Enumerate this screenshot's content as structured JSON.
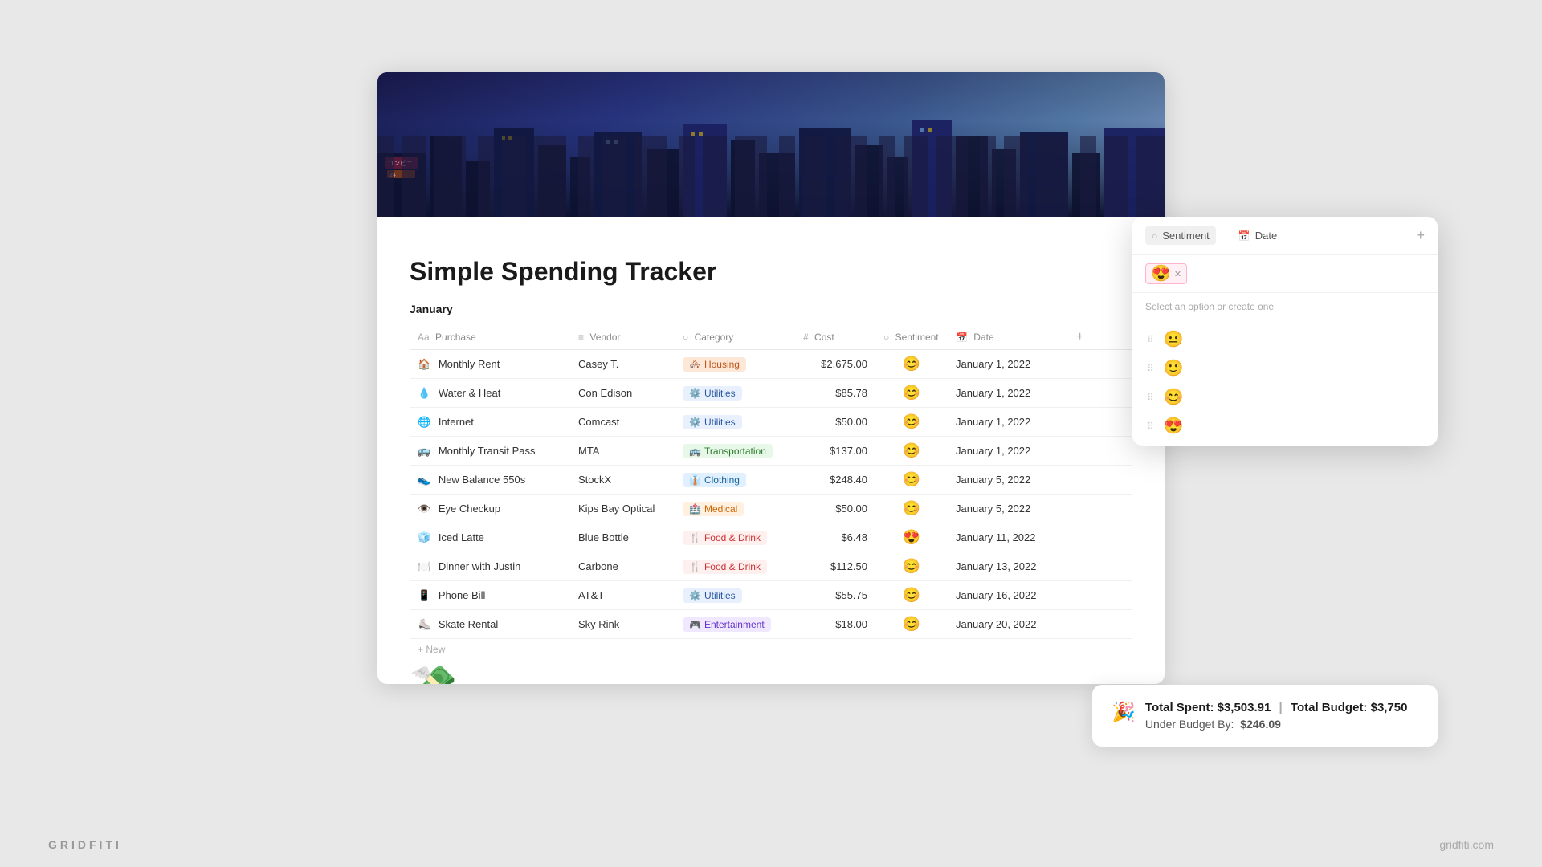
{
  "page": {
    "title": "Simple Spending Tracker",
    "icon": "💸",
    "section": "January"
  },
  "table": {
    "columns": [
      {
        "key": "purchase",
        "label": "Purchase",
        "icon": "Aa"
      },
      {
        "key": "vendor",
        "label": "Vendor",
        "icon": "≡"
      },
      {
        "key": "category",
        "label": "Category",
        "icon": "○"
      },
      {
        "key": "cost",
        "label": "Cost",
        "icon": "#"
      },
      {
        "key": "sentiment",
        "label": "Sentiment",
        "icon": "○"
      },
      {
        "key": "date",
        "label": "Date",
        "icon": "📅"
      }
    ],
    "rows": [
      {
        "icon": "🏠",
        "purchase": "Monthly Rent",
        "vendor": "Casey T.",
        "category": "Housing",
        "categoryTag": "housing",
        "categoryIcon": "🏘️",
        "cost": "$2,675.00",
        "sentiment": "😊",
        "date": "January 1, 2022",
        "rowNum": "00"
      },
      {
        "icon": "💧",
        "purchase": "Water & Heat",
        "vendor": "Con Edison",
        "category": "Utilities",
        "categoryTag": "utilities",
        "categoryIcon": "⚙️",
        "cost": "$85.78",
        "sentiment": "😊",
        "date": "January 1, 2022",
        "rowNum": "78"
      },
      {
        "icon": "🌐",
        "purchase": "Internet",
        "vendor": "Comcast",
        "category": "Utilities",
        "categoryTag": "utilities",
        "categoryIcon": "⚙️",
        "cost": "$50.00",
        "sentiment": "😊",
        "date": "January 1, 2022",
        "rowNum": "00"
      },
      {
        "icon": "🚌",
        "purchase": "Monthly Transit Pass",
        "vendor": "MTA",
        "category": "Transportation",
        "categoryTag": "transport",
        "categoryIcon": "🚌",
        "cost": "$137.00",
        "sentiment": "😊",
        "date": "January 1, 2022",
        "rowNum": "00"
      },
      {
        "icon": "👟",
        "purchase": "New Balance 550s",
        "vendor": "StockX",
        "category": "Clothing",
        "categoryTag": "clothing",
        "categoryIcon": "👔",
        "cost": "$248.40",
        "sentiment": "😊",
        "date": "January 5, 2022",
        "rowNum": "00"
      },
      {
        "icon": "👁️",
        "purchase": "Eye Checkup",
        "vendor": "Kips Bay Optical",
        "category": "Medical",
        "categoryTag": "medical",
        "categoryIcon": "🏥",
        "cost": "$50.00",
        "sentiment": "😊",
        "date": "January 5, 2022",
        "rowNum": "00"
      },
      {
        "icon": "🧊",
        "purchase": "Iced Latte",
        "vendor": "Blue Bottle",
        "category": "Food & Drink",
        "categoryTag": "food",
        "categoryIcon": "🍴",
        "cost": "$6.48",
        "sentiment": "😍",
        "date": "January 11, 2022",
        "rowNum": "48"
      },
      {
        "icon": "🍽️",
        "purchase": "Dinner with Justin",
        "vendor": "Carbone",
        "category": "Food & Drink",
        "categoryTag": "food",
        "categoryIcon": "🍴",
        "cost": "$112.50",
        "sentiment": "😊",
        "date": "January 13, 2022",
        "rowNum": "50"
      },
      {
        "icon": "📱",
        "purchase": "Phone Bill",
        "vendor": "AT&T",
        "category": "Utilities",
        "categoryTag": "utilities",
        "categoryIcon": "⚙️",
        "cost": "$55.75",
        "sentiment": "😊",
        "date": "January 16, 2022",
        "rowNum": "75"
      },
      {
        "icon": "⛸️",
        "purchase": "Skate Rental",
        "vendor": "Sky Rink",
        "category": "Entertainment",
        "categoryTag": "entertainment",
        "categoryIcon": "🎮",
        "cost": "$18.00",
        "sentiment": "😊",
        "date": "January 20, 2022",
        "rowNum": "00"
      }
    ]
  },
  "sentiment_popup": {
    "tabs": [
      {
        "label": "Sentiment",
        "icon": "○",
        "active": true
      },
      {
        "label": "Date",
        "icon": "📅",
        "active": false
      }
    ],
    "selected_emoji": "😍",
    "hint": "Select an option or create one",
    "options": [
      {
        "emoji": "😐",
        "id": "neutral"
      },
      {
        "emoji": "🙂",
        "id": "ok"
      },
      {
        "emoji": "😊",
        "id": "happy"
      },
      {
        "emoji": "😍",
        "id": "love"
      }
    ],
    "add_label": "+"
  },
  "budget": {
    "icon": "🎉",
    "total_spent_label": "Total Spent:",
    "total_spent_value": "$3,503.91",
    "separator": "|",
    "total_budget_label": "Total Budget:",
    "total_budget_value": "$3,750",
    "under_budget_label": "Under Budget By:",
    "under_budget_value": "$246.09"
  },
  "watermarks": {
    "left": "GRIDFITI",
    "right": "gridfiti.com"
  }
}
